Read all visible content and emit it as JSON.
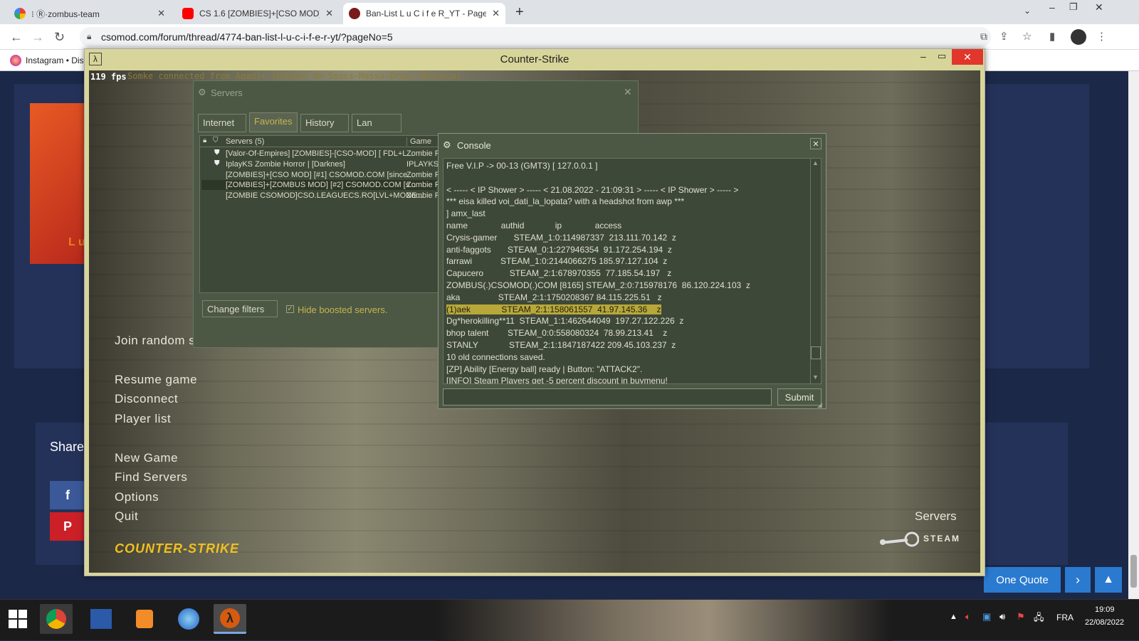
{
  "browser": {
    "tabs": [
      {
        "title": "⁝ Ⓡ·zombus-team",
        "active": false
      },
      {
        "title": "CS 1.6 [ZOMBIES]+[CSO MOD] [F",
        "active": false
      },
      {
        "title": "Ban-List L u C i f e R_YT - Page 5",
        "active": true
      }
    ],
    "url": "csomod.com/forum/thread/4774-ban-list-l-u-c-i-f-e-r-yt/?pageNo=5",
    "bookmark": "Instagram • Dis"
  },
  "page": {
    "share_label": "Share",
    "quote_button": "One Quote",
    "user_initial": "L u"
  },
  "cs": {
    "window_title": "Counter-Strike",
    "fps": "119 fps",
    "notice": "Somke connected from Agadir (Region de Souss-Massa-Draa, Morocco)",
    "menu": {
      "join_random": "Join random s",
      "resume": "Resume game",
      "disconnect": "Disconnect",
      "player_list": "Player list",
      "new_game": "New Game",
      "find_servers": "Find Servers",
      "options": "Options",
      "quit": "Quit"
    },
    "logo": "COUNTER-STRIKE",
    "steam_servers": "Servers",
    "steam_label": "STEAM"
  },
  "servers": {
    "title": "Servers",
    "tabs": [
      "Internet",
      "Favorites",
      "History",
      "Lan"
    ],
    "header_servers": "Servers (5)",
    "header_game": "Game",
    "rows": [
      {
        "name": "[Valor-Of-Empires] [ZOMBIES]-[CSO-MOD] [ FDL+L...",
        "game": "Zombie Pl"
      },
      {
        "name": "IplayKS Zombie Horror | [Darknes]",
        "game": "IPLAYKS#"
      },
      {
        "name": "[ZOMBIES]+[CSO MOD] [#1] CSOMOD.COM [since...",
        "game": "Zombie Pl"
      },
      {
        "name": "[ZOMBIES]+[ZOMBUS MOD] [#2] CSOMOD.COM [s...",
        "game": "Zombie Pl"
      },
      {
        "name": "[ZOMBIE CSOMOD]CSO.LEAGUECS.RO[LVL+MONE...",
        "game": "Zombie Pl"
      }
    ],
    "change_filters": "Change filters",
    "hide_boosted": "Hide boosted servers."
  },
  "console": {
    "title": "Console",
    "lines": [
      "Free V.I.P -> 00-13 (GMT3) [ 127.0.0.1 ]",
      "",
      "< ----- < IP Shower > ----- < 21.08.2022 - 21:09:31 > ----- < IP Shower > ----- >",
      "*** eisa killed voi_dati_la_lopata? with a headshot from awp ***",
      "] amx_last",
      "name              authid             ip              access",
      "Crysis-gamer       STEAM_1:0:114987337  213.111.70.142  z",
      "anti-faggots       STEAM_0:1:227946354  91.172.254.194  z",
      "farrawi            STEAM_1:0:2144066275 185.97.127.104  z",
      "Capucero           STEAM_2:1:678970355  77.185.54.197   z",
      "ZOMBUS(.)CSOMOD(.)COM [8165] STEAM_2:0:715978176  86.120.224.103  z",
      "aka                STEAM_2:1:1750208367 84.115.225.51   z",
      "(1)aek             STEAM_2:1:158061557  41.97.145.36    z",
      "Dg*herokilling**11  STEAM_1:1:462644049  197.27.122.226  z",
      "bhop talent        STEAM_0:0:558080324  78.99.213.41    z",
      "STANLY             STEAM_2:1:1847187422 209.45.103.237  z",
      "10 old connections saved.",
      "[ZP] Ability [Energy ball] ready | Button: \"ATTACK2\".",
      "[INFO] Steam Players get -5 percent discount in buymenu!"
    ],
    "highlighted_line": 12,
    "submit": "Submit"
  },
  "taskbar": {
    "lang": "FRA",
    "time": "19:09",
    "date": "22/08/2022"
  }
}
